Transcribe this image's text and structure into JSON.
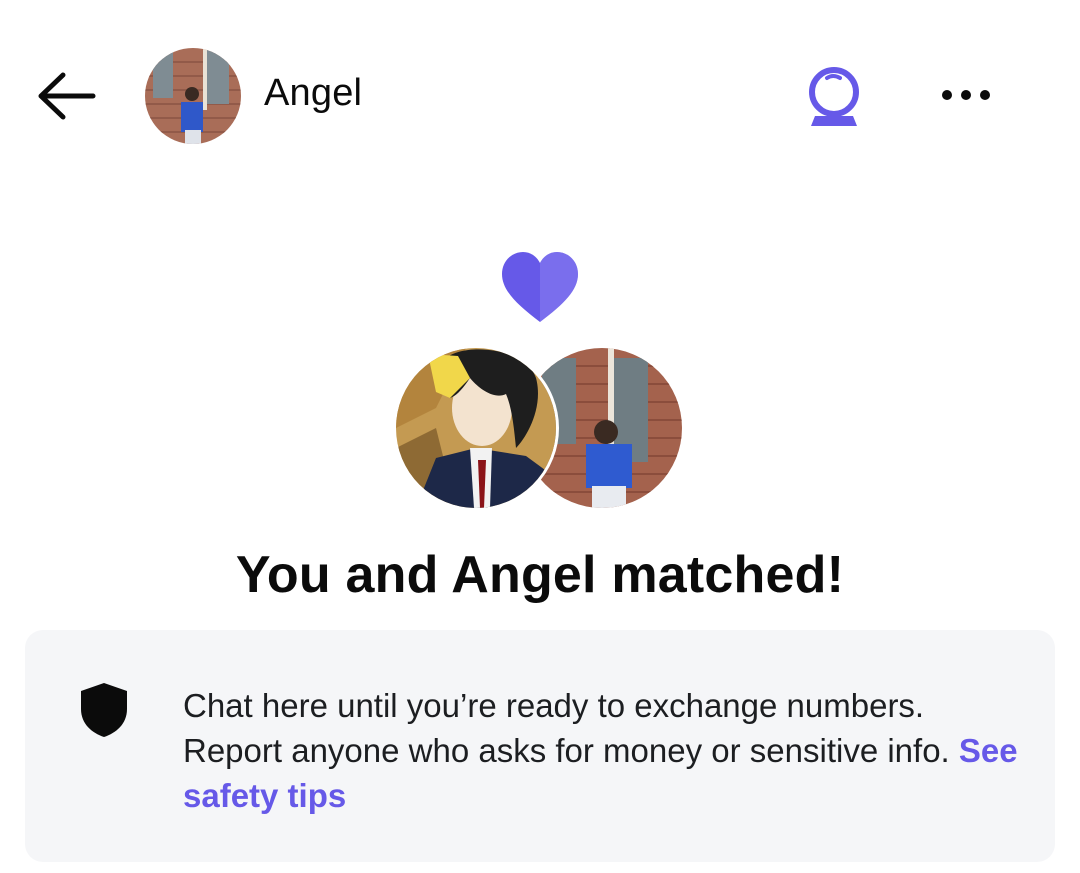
{
  "header": {
    "back_icon": "arrow-left-icon",
    "name": "Angel",
    "avatar": "profile-photo-angel",
    "crystal_icon": "crystal-ball-icon",
    "more_icon": "more-horizontal-icon"
  },
  "match": {
    "heart_icon": "heart-icon",
    "title": "You and Angel matched!"
  },
  "safety": {
    "icon": "shield-icon",
    "text": "Chat here until you’re ready to exchange numbers. Report anyone who asks for money or sensitive info.",
    "link": "See safety tips"
  },
  "colors": {
    "accent": "#6659e8",
    "card_bg": "#f5f6f8",
    "text": "#0b0b0b"
  }
}
